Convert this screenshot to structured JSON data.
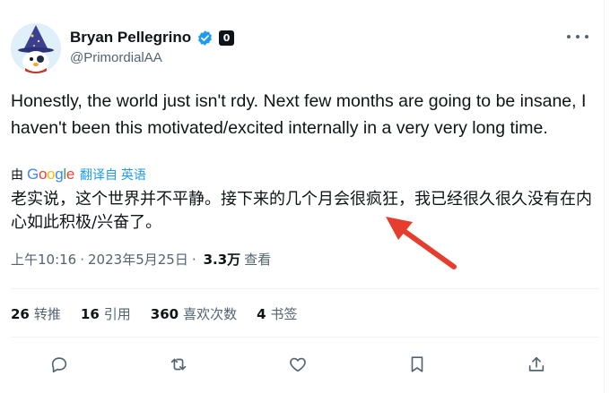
{
  "author": {
    "display_name": "Bryan Pellegrino",
    "handle": "@PrimordialAA",
    "affiliate_badge": "0",
    "avatar_icon": "wizard-avatar",
    "verified_color": "#1d9bf0"
  },
  "tweet": {
    "text": "Honestly, the world just isn't rdy. Next few months are going to be insane, I haven't been this motivated/excited internally in a very very long time."
  },
  "translation": {
    "by_label": "由",
    "provider": "Google",
    "link_label": "翻译自 英语",
    "translated_text": "老实说，这个世界并不平静。接下来的几个月会很疯狂，我已经很久很久没有在内心如此积极/兴奋了。"
  },
  "meta": {
    "time": "上午10:16",
    "separator": "·",
    "date": "2023年5月25日",
    "views_count": "3.3万",
    "views_label": "查看"
  },
  "stats": [
    {
      "num": "26",
      "label": "转推"
    },
    {
      "num": "16",
      "label": "引用"
    },
    {
      "num": "360",
      "label": "喜欢次数"
    },
    {
      "num": "4",
      "label": "书签"
    }
  ],
  "actions": [
    "reply-icon",
    "retweet-icon",
    "like-icon",
    "bookmark-icon",
    "share-icon"
  ],
  "colors": {
    "text": "#0f1419",
    "secondary": "#536471",
    "link": "#1d9bf0",
    "annotation_arrow": "#e53e2f"
  }
}
